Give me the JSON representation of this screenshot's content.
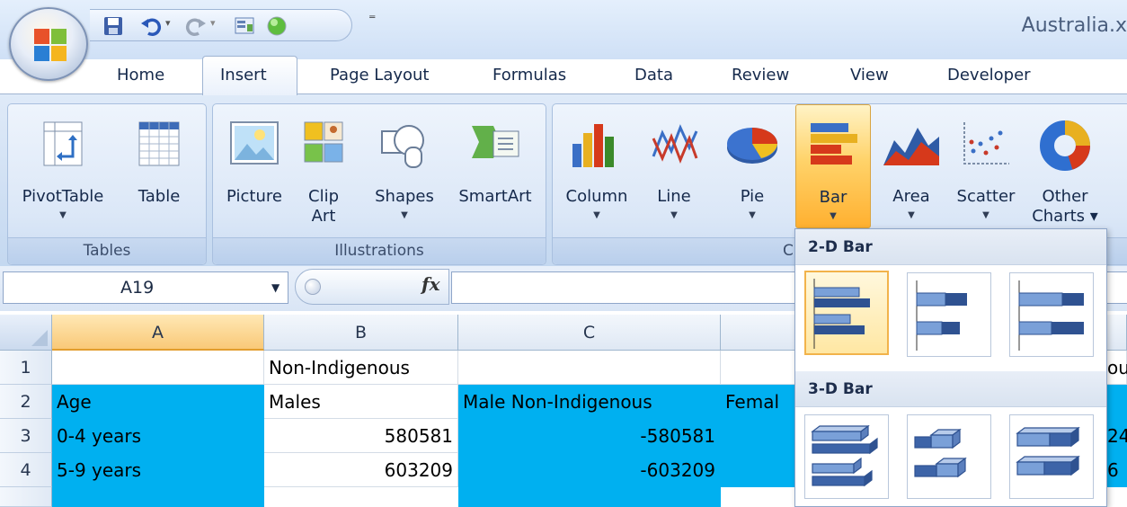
{
  "window": {
    "title": "Australia.x"
  },
  "quick_access": {
    "more_symbol": "⁼"
  },
  "tabs": [
    "Home",
    "Insert",
    "Page Layout",
    "Formulas",
    "Data",
    "Review",
    "View",
    "Developer"
  ],
  "active_tab": "Insert",
  "ribbon": {
    "tables": {
      "label": "Tables",
      "pivottable": "PivotTable",
      "table": "Table"
    },
    "illustrations": {
      "label": "Illustrations",
      "picture": "Picture",
      "clip_art": "Clip\nArt",
      "shapes": "Shapes",
      "smartart": "SmartArt"
    },
    "charts": {
      "label": "C",
      "column": "Column",
      "line": "Line",
      "pie": "Pie",
      "bar": "Bar",
      "area": "Area",
      "scatter": "Scatter",
      "other": "Other\nCharts ▾"
    }
  },
  "formula_bar": {
    "name_box": "A19",
    "fx": "fx",
    "content": ""
  },
  "grid": {
    "columns": [
      "A",
      "B",
      "C"
    ],
    "rows": [
      {
        "num": "1",
        "A": "",
        "B": "Non-Indigenous",
        "C": "",
        "D": "",
        "tail": "ou"
      },
      {
        "num": "2",
        "A": "Age",
        "B": "Males",
        "C": "Male Non-Indigenous",
        "D": "Femal",
        "tail": ""
      },
      {
        "num": "3",
        "A": "0-4 years",
        "B": "580581",
        "C": "-580581",
        "D": "",
        "tail": "24"
      },
      {
        "num": "4",
        "A": "5-9 years",
        "B": "603209",
        "C": "-603209",
        "D": "",
        "tail": "6"
      }
    ]
  },
  "bar_menu": {
    "sections": [
      {
        "title": "2-D Bar",
        "items": [
          "clustered-bar",
          "stacked-bar",
          "100-stacked-bar"
        ]
      },
      {
        "title": "3-D Bar",
        "items": [
          "3d-clustered-bar",
          "3d-stacked-bar",
          "3d-100-stacked-bar"
        ]
      }
    ]
  },
  "colors": {
    "cyan_fill": "#00b0f0",
    "highlight": "#ffd36a"
  }
}
